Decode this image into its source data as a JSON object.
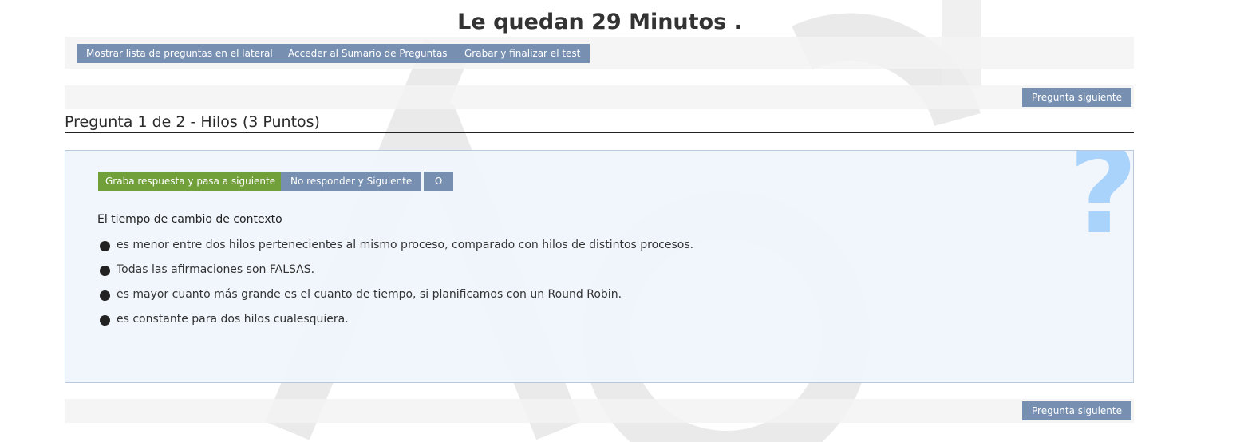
{
  "header": {
    "timer_text": "Le quedan 29 Minutos ."
  },
  "toolbar": {
    "show_list_label": "Mostrar lista de preguntas en el lateral",
    "summary_label": "Acceder al Sumario de Preguntas",
    "finish_label": "Grabar y finalizar el test"
  },
  "top_nav": {
    "next_label": "Pregunta siguiente"
  },
  "question": {
    "title": "Pregunta 1 de 2 - Hilos (3 Puntos)",
    "save_next_label": "Graba respuesta y pasa a siguiente",
    "skip_label": "No responder y Siguiente",
    "omega_label": "Ω",
    "help_icon": "question-mark-icon",
    "statement": "El tiempo de cambio de contexto",
    "options": [
      "es menor entre dos hilos pertenecientes al mismo proceso, comparado con hilos de distintos procesos.",
      "Todas las afirmaciones son FALSAS.",
      "es mayor cuanto más grande es el cuanto de tiempo, si planificamos con un Round Robin.",
      "es constante para dos hilos cualesquiera."
    ]
  },
  "bottom_nav": {
    "next_label": "Pregunta siguiente"
  },
  "colors": {
    "button_blue": "#7790b1",
    "button_green": "#71a03b",
    "panel_bg": "#f0f5fd",
    "help_icon": "#a9d3fb"
  }
}
